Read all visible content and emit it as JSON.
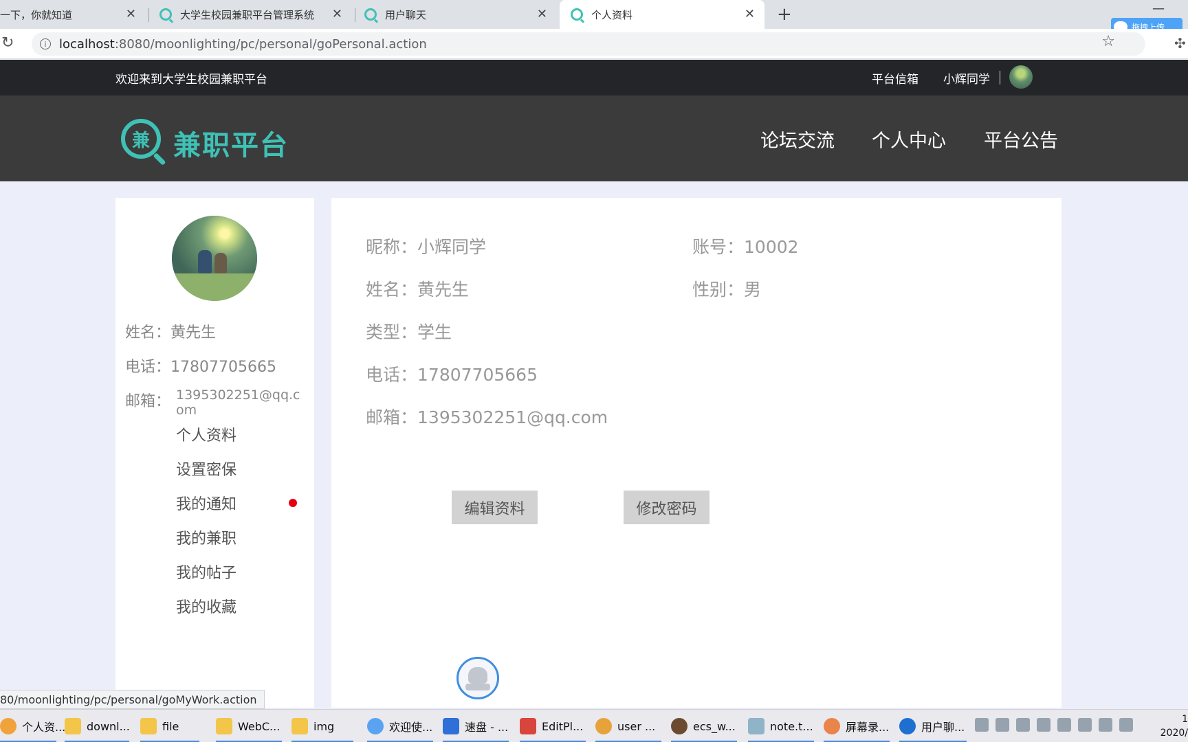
{
  "browser": {
    "tabs": [
      {
        "title": "一下，你就知道",
        "active": false
      },
      {
        "title": "大学生校园兼职平台管理系统",
        "active": false
      },
      {
        "title": "用户聊天",
        "active": false
      },
      {
        "title": "个人资料",
        "active": true
      }
    ],
    "close_glyph": "✕",
    "new_tab_glyph": "+",
    "url_host": "localhost",
    "url_path": ":8080/moonlighting/pc/personal/goPersonal.action",
    "upload_badge": "拖拽上传",
    "status_url": "80/moonlighting/pc/personal/goMyWork.action"
  },
  "site": {
    "welcome": "欢迎来到大学生校园兼职平台",
    "msgbox": "平台信箱",
    "username": "小辉同学",
    "logo_char": "兼",
    "logo_text": "兼职平台",
    "nav": [
      "论坛交流",
      "个人中心",
      "平台公告"
    ],
    "accent_color": "#3fc1b6"
  },
  "sidebar": {
    "name_line": "姓名：黄先生",
    "phone_line": "电话：17807705665",
    "email_label": "邮箱：",
    "email_value": "1395302251@qq.com",
    "menu": [
      "个人资料",
      "设置密保",
      "我的通知",
      "我的兼职",
      "我的帖子",
      "我的收藏"
    ],
    "notify_dot_color": "#e60012"
  },
  "profile": {
    "nickname_label": "昵称：",
    "nickname": "小辉同学",
    "account_label": "账号：",
    "account": "10002",
    "name_label": "姓名：",
    "name": "黄先生",
    "gender_label": "性别：",
    "gender": "男",
    "type_label": "类型：",
    "type": "学生",
    "phone_label": "电话：",
    "phone": "17807705665",
    "email_label": "邮箱：",
    "email": "1395302251@qq.com",
    "edit_button": "编辑资料",
    "password_button": "修改密码"
  },
  "taskbar": {
    "items": [
      "个人资...",
      "downl...",
      "file",
      "WebC...",
      "img",
      "欢迎使...",
      "速盘 - ...",
      "EditPl...",
      "user ...",
      "ecs_w...",
      "note.t...",
      "屏幕录...",
      "用户聊..."
    ],
    "clock_line1": "1",
    "clock_line2": "2020/"
  }
}
